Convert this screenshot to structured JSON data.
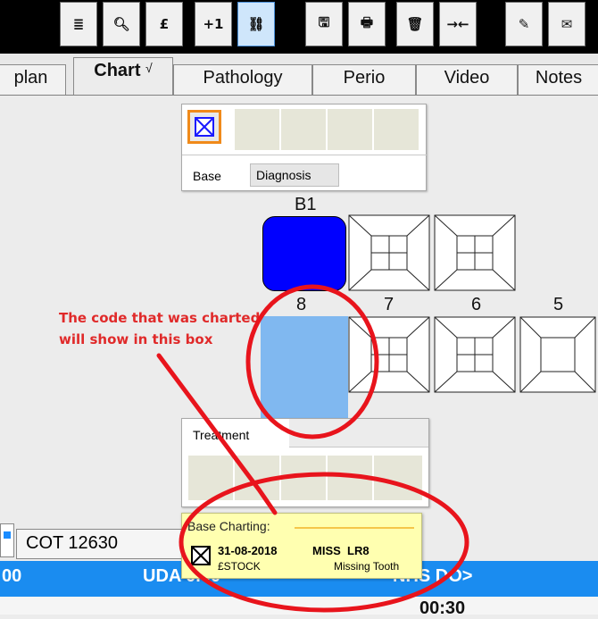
{
  "toolbar": {
    "buttons": [
      {
        "icon": "list-icon",
        "glyph": "≣"
      },
      {
        "icon": "search-icon",
        "glyph": "🔍︎"
      },
      {
        "icon": "pound-icon",
        "glyph": "£"
      },
      {
        "icon": "plus-one-icon",
        "glyph": "+1"
      },
      {
        "icon": "link-icon",
        "glyph": "⛓"
      },
      {
        "icon": "save-icon",
        "glyph": "🖫"
      },
      {
        "icon": "print-icon",
        "glyph": "🖶"
      },
      {
        "icon": "trash-icon",
        "glyph": "🗑"
      },
      {
        "icon": "merge-icon",
        "glyph": "→←"
      },
      {
        "icon": "pen-icon",
        "glyph": "✎"
      },
      {
        "icon": "envelope-icon",
        "glyph": "✉"
      }
    ]
  },
  "tabs": {
    "plan": "plan",
    "chart": "Chart",
    "chart_mark": "√",
    "pathology": "Pathology",
    "perio": "Perio",
    "video": "Video",
    "notes": "Notes"
  },
  "base_popup": {
    "tab_base": "Base",
    "tab_diagnosis": "Diagnosis"
  },
  "chart": {
    "b1": "B1",
    "teeth": [
      "8",
      "7",
      "6",
      "5"
    ],
    "colors": {
      "selected": "#0000ff",
      "highlight": "#80b8f0"
    }
  },
  "treatment_popup": {
    "title": "Treatment"
  },
  "tooltip": {
    "heading": "Base Charting:",
    "date": "31-08-2018",
    "code": "MISS  LR8",
    "user": "£STOCK",
    "description": "Missing Tooth"
  },
  "bottom": {
    "cot": "COT 12630",
    "row_left": "00",
    "row_mid": "UDA 0.00",
    "row_right": "NHS DO>",
    "time": "00:30"
  },
  "annotation": "The code that was charted will show in this box"
}
